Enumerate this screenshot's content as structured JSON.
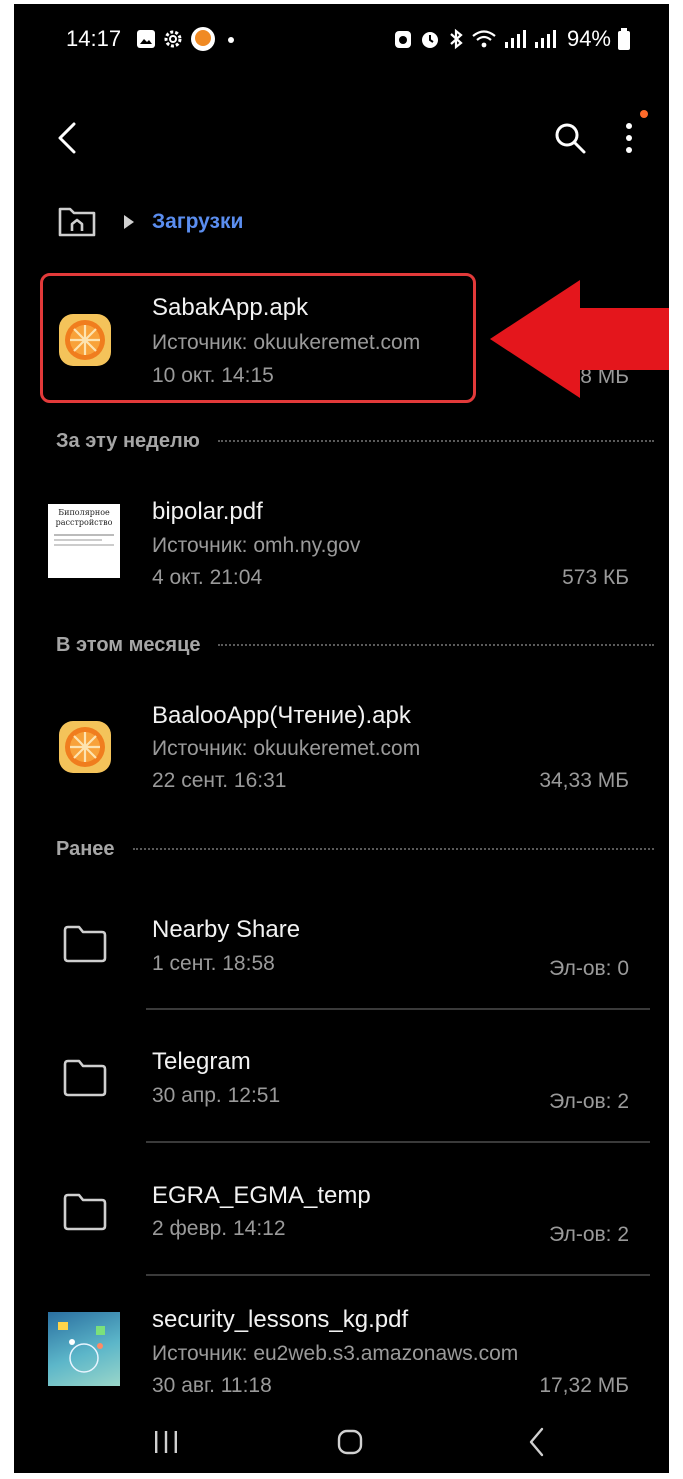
{
  "status_bar": {
    "time": "14:17",
    "battery": "94%"
  },
  "breadcrumb": {
    "current": "Загрузки"
  },
  "highlighted_item": {
    "name": "SabakApp.apk",
    "source": "Источник: okuukeremet.com",
    "date": "10 окт. 14:15",
    "size_partial": "78 МБ"
  },
  "sections": {
    "this_week": "За эту неделю",
    "this_month": "В этом месяце",
    "earlier": "Ранее"
  },
  "files": {
    "bipolar": {
      "name": "bipolar.pdf",
      "source": "Источник: omh.ny.gov",
      "date": "4 окт. 21:04",
      "size": "573 КБ",
      "thumb_text": "Биполярное расстройство"
    },
    "baaloo": {
      "name": "BaalooApp(Чтение).apk",
      "source": "Источник: okuukeremet.com",
      "date": "22 сент. 16:31",
      "size": "34,33 МБ"
    },
    "nearby": {
      "name": "Nearby Share",
      "date": "1 сент. 18:58",
      "count": "Эл-ов: 0"
    },
    "telegram": {
      "name": "Telegram",
      "date": "30 апр. 12:51",
      "count": "Эл-ов: 2"
    },
    "egra": {
      "name": "EGRA_EGMA_temp",
      "date": "2 февр. 14:12",
      "count": "Эл-ов: 2"
    },
    "security": {
      "name": "security_lessons_kg.pdf",
      "source": "Источник: eu2web.s3.amazonaws.com",
      "date": "30 авг. 11:18",
      "size": "17,32 МБ"
    }
  },
  "colors": {
    "accent": "#5b8ef0",
    "highlight": "#e23a3a",
    "background": "#000000"
  },
  "icons": [
    "back-icon",
    "search-icon",
    "more-vert-icon",
    "home-icon",
    "folder-icon",
    "apk-orange-icon",
    "recents-icon",
    "nav-home-icon",
    "nav-back-icon"
  ]
}
